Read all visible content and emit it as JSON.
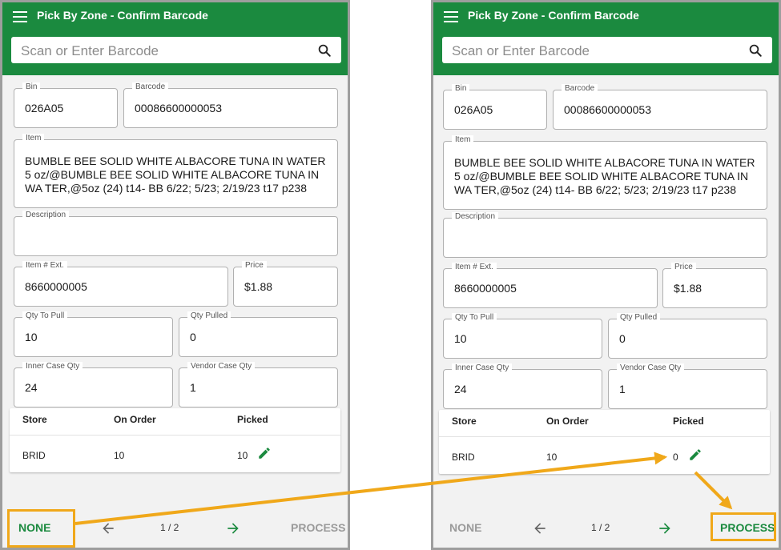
{
  "app_title": "Pick By Zone - Confirm Barcode",
  "search": {
    "placeholder": "Scan or Enter Barcode"
  },
  "labels": {
    "bin": "Bin",
    "barcode": "Barcode",
    "item": "Item",
    "description": "Description",
    "item_ext": "Item # Ext.",
    "price": "Price",
    "qty_to_pull": "Qty To Pull",
    "qty_pulled": "Qty Pulled",
    "inner_case_qty": "Inner Case Qty",
    "vendor_case_qty": "Vendor Case Qty"
  },
  "values": {
    "bin": "026A05",
    "barcode": "00086600000053",
    "item": "BUMBLE BEE SOLID WHITE ALBACORE TUNA IN WATER 5 oz/@BUMBLE BEE SOLID WHITE ALBACORE TUNA IN WA TER,@5oz (24) t14- BB 6/22; 5/23; 2/19/23 t17 p238",
    "description": "",
    "item_ext": "8660000005",
    "price": "$1.88",
    "qty_to_pull": "10",
    "qty_pulled": "0",
    "inner_case_qty": "24",
    "vendor_case_qty": "1"
  },
  "table": {
    "headers": [
      "Store",
      "On Order",
      "Picked"
    ],
    "left_row": {
      "store": "BRID",
      "on_order": "10",
      "picked": "10"
    },
    "right_row": {
      "store": "BRID",
      "on_order": "10",
      "picked": "0"
    }
  },
  "bottom": {
    "none": "NONE",
    "process": "PROCESS",
    "page": "1 / 2"
  },
  "colors": {
    "brand_green": "#1b8a3f",
    "highlight": "#f0a81a"
  },
  "icons": [
    "menu-icon",
    "search-icon",
    "pencil-icon",
    "arrow-back-icon",
    "arrow-forward-icon"
  ]
}
